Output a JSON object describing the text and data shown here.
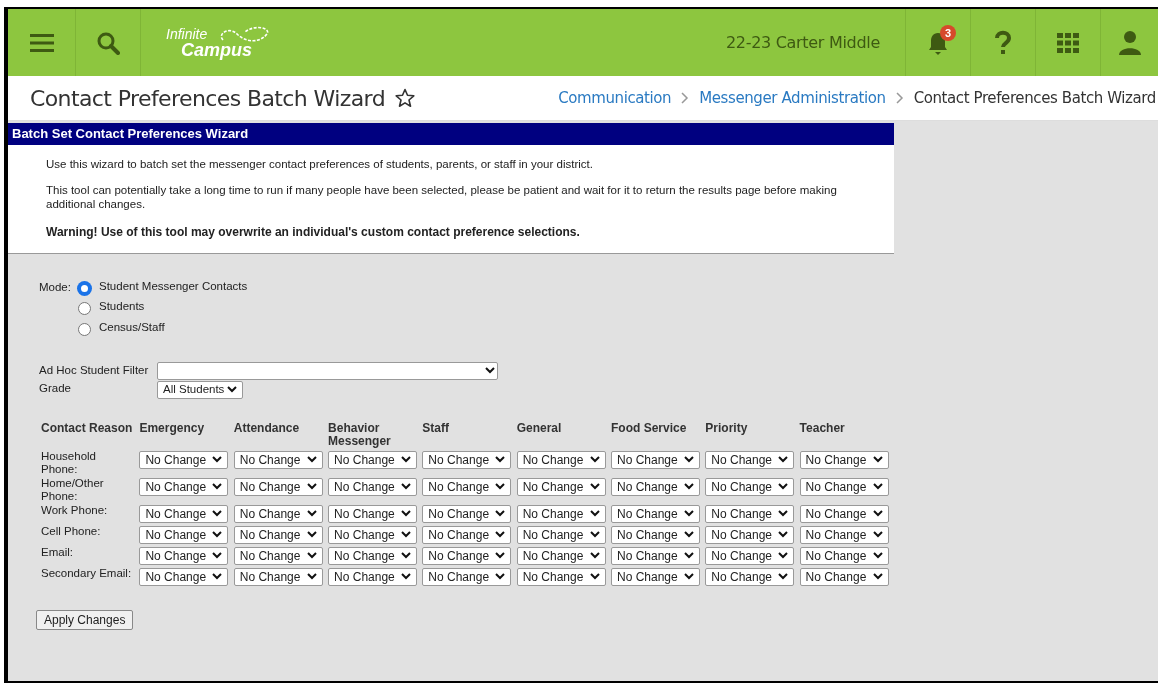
{
  "header": {
    "logo": [
      "Infinite",
      "Campus"
    ],
    "school": "22-23 Carter Middle",
    "notification_count": "3"
  },
  "page": {
    "title": "Contact Preferences Batch Wizard",
    "favorite": false,
    "breadcrumbs": [
      {
        "label": "Communication",
        "link": true
      },
      {
        "label": "Messenger Administration",
        "link": true
      },
      {
        "label": "Contact Preferences Batch Wizard",
        "link": false
      }
    ]
  },
  "wizard": {
    "title": "Batch Set Contact Preferences Wizard",
    "intro": [
      "Use this wizard to batch set the messenger contact preferences of students, parents, or staff in your district.",
      "This tool can potentially take a long time to run if many people have been selected, please be patient and wait for it to return the results page before making additional changes."
    ],
    "warning": "Warning! Use of this tool may overwrite an individual's custom contact preference selections.",
    "mode_label": "Mode:",
    "modes": [
      {
        "label": "Student Messenger Contacts",
        "selected": true
      },
      {
        "label": "Students",
        "selected": false
      },
      {
        "label": "Census/Staff",
        "selected": false
      }
    ],
    "ad_hoc_filter": {
      "label": "Ad Hoc Student Filter"
    },
    "grade": {
      "label": "Grade",
      "value": "All Students"
    },
    "table": {
      "row_heading": "Contact Reason",
      "columns": [
        "Emergency",
        "Attendance",
        "Behavior Messenger",
        "Staff",
        "General",
        "Food Service",
        "Priority",
        "Teacher"
      ],
      "rows": [
        {
          "label": "Household Phone:",
          "cells": [
            "No Change",
            "No Change",
            "No Change",
            "No Change",
            "No Change",
            "No Change",
            "No Change",
            "No Change"
          ]
        },
        {
          "label": "Home/Other Phone:",
          "cells": [
            "No Change",
            "No Change",
            "No Change",
            "No Change",
            "No Change",
            "No Change",
            "No Change",
            "No Change"
          ]
        },
        {
          "label": "Work Phone:",
          "cells": [
            "No Change",
            "No Change",
            "No Change",
            "No Change",
            "No Change",
            "No Change",
            "No Change",
            "No Change"
          ]
        },
        {
          "label": "Cell Phone:",
          "cells": [
            "No Change",
            "No Change",
            "No Change",
            "No Change",
            "No Change",
            "No Change",
            "No Change",
            "No Change"
          ]
        },
        {
          "label": "Email:",
          "cells": [
            "No Change",
            "No Change",
            "No Change",
            "No Change",
            "No Change",
            "No Change",
            "No Change",
            "No Change"
          ]
        },
        {
          "label": "Secondary Email:",
          "cells": [
            "No Change",
            "No Change",
            "No Change",
            "No Change",
            "No Change",
            "No Change",
            "No Change",
            "No Change"
          ]
        }
      ]
    },
    "apply_button": "Apply Changes"
  }
}
